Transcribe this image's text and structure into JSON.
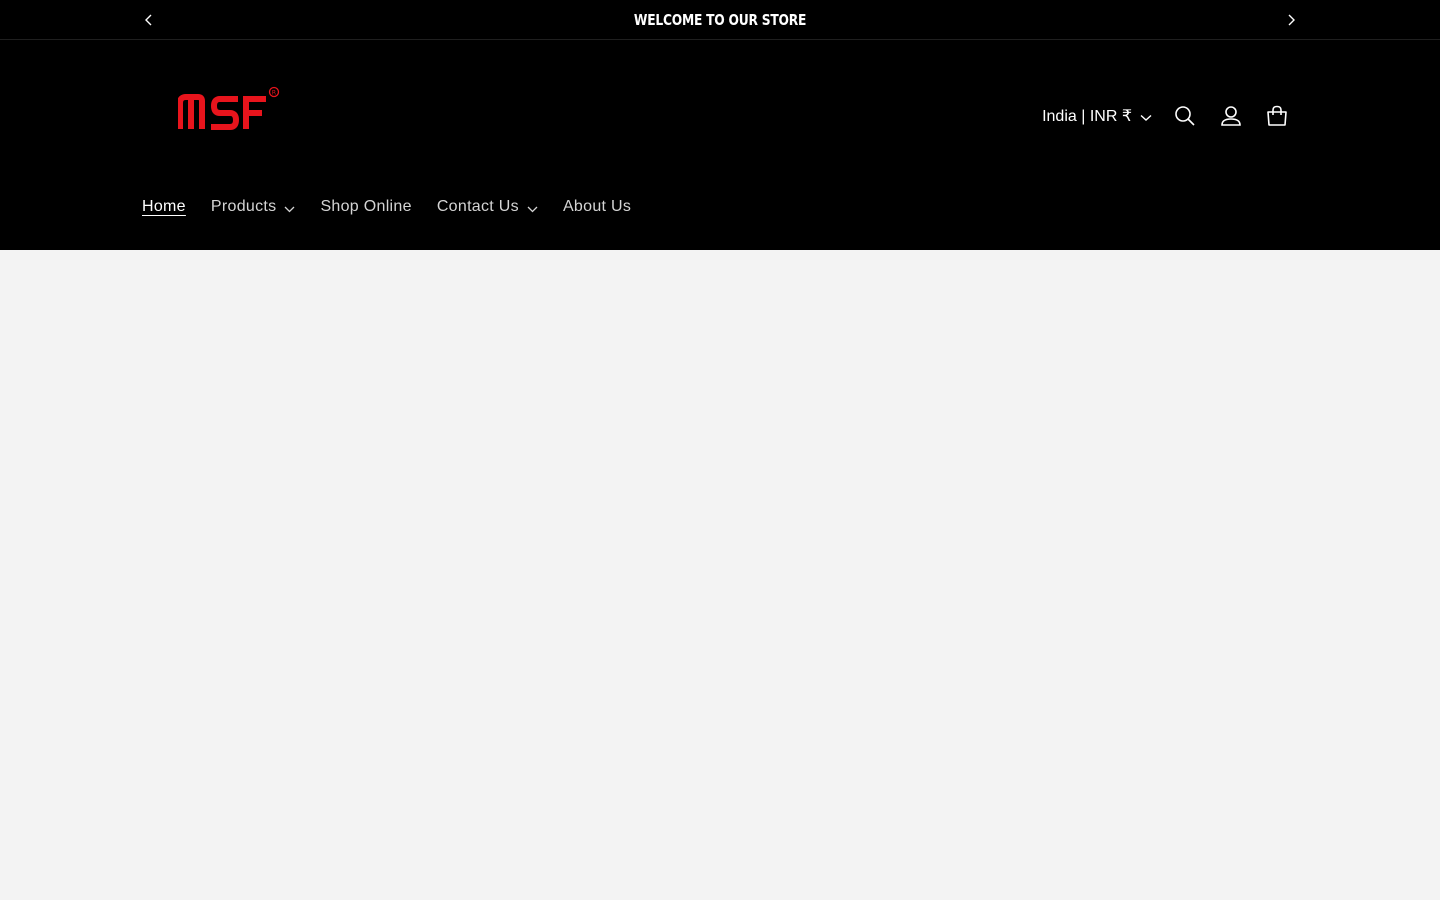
{
  "announcement": {
    "message": "WELCOME TO OUR STORE",
    "prev_icon": "chevron-left-icon",
    "next_icon": "chevron-right-icon"
  },
  "header": {
    "logo_text": "MSF",
    "logo_mark": "®",
    "country_selector": "India | INR ₹",
    "icons": [
      "search-icon",
      "account-icon",
      "cart-icon"
    ]
  },
  "nav": {
    "items": [
      {
        "label": "Home",
        "active": true,
        "dropdown": false
      },
      {
        "label": "Products",
        "active": false,
        "dropdown": true
      },
      {
        "label": "Shop Online",
        "active": false,
        "dropdown": false
      },
      {
        "label": "Contact Us",
        "active": false,
        "dropdown": true
      },
      {
        "label": "About Us",
        "active": false,
        "dropdown": false
      }
    ]
  },
  "colors": {
    "header_bg": "#000000",
    "page_bg": "#f3f3f3",
    "logo_red": "#e8141c",
    "text_white": "#ffffff",
    "nav_text": "#d4d4d4"
  }
}
